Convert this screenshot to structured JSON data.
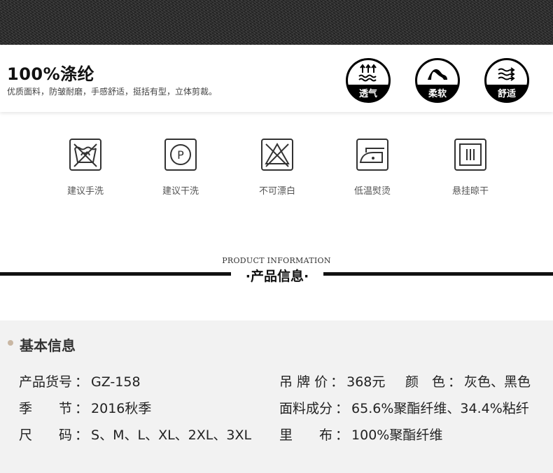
{
  "material": {
    "title": "100%涤纶",
    "description": "优质面料，防皱耐磨，手感舒适，挺括有型，立体剪裁。",
    "features": [
      {
        "label": "透气",
        "icon": "breathable-icon"
      },
      {
        "label": "柔软",
        "icon": "soft-icon"
      },
      {
        "label": "舒适",
        "icon": "comfortable-icon"
      }
    ]
  },
  "care": [
    {
      "label": "建议手洗",
      "icon": "hand-wash-icon"
    },
    {
      "label": "建议干洗",
      "icon": "dry-clean-icon"
    },
    {
      "label": "不可漂白",
      "icon": "no-bleach-icon"
    },
    {
      "label": "低温熨烫",
      "icon": "low-iron-icon"
    },
    {
      "label": "悬挂晾干",
      "icon": "hang-dry-icon"
    }
  ],
  "section": {
    "title_en": "PRODUCT INFORMATION",
    "title_cn": "·产品信息·"
  },
  "basic_info": {
    "heading": "基本信息",
    "sep": "：",
    "rows": [
      {
        "label": "产品货号",
        "value": "GZ-158"
      },
      {
        "label": "吊 牌 价",
        "value": "368元"
      },
      {
        "label": "颜　色",
        "value": "灰色、黑色"
      },
      {
        "label": "季　　节",
        "value": "2016秋季"
      },
      {
        "label": "面料成分",
        "value": "65.6%聚酯纤维、34.4%粘纤"
      },
      {
        "label": "尺　　码",
        "value": "S、M、L、XL、2XL、3XL"
      },
      {
        "label": "里　　布",
        "value": "100%聚酯纤维"
      }
    ]
  }
}
